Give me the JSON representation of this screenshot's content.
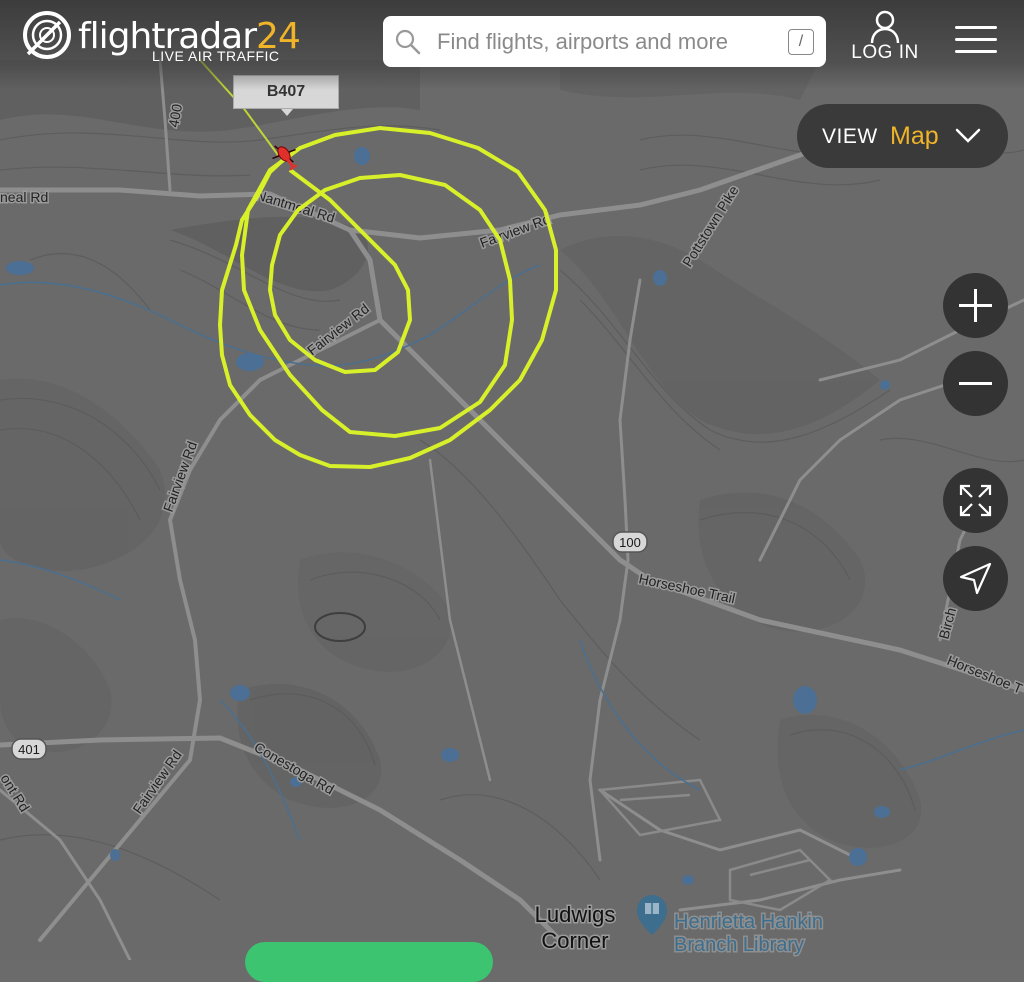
{
  "header": {
    "logo_name": "flightradar",
    "logo_num": "24",
    "logo_sub": "LIVE AIR TRAFFIC",
    "search_placeholder": "Find flights, airports and more",
    "search_shortcut": "/",
    "login_label": "LOG IN"
  },
  "view": {
    "label": "VIEW",
    "value": "Map"
  },
  "aircraft": {
    "callsign": "B407",
    "track_color": "#d8f02a",
    "icon_color": "#e0302c"
  },
  "map_labels": {
    "roads": [
      "Nantmeal Rd",
      "neal Rd",
      "Fairview Rd",
      "Pottstown Pike",
      "Fairview Rd",
      "Fairview Rd",
      "Horseshoe Trail",
      "Horseshoe T",
      "Conestoga Rd",
      "Fairview Rd",
      "ont Rd",
      "Birch"
    ],
    "route_shields": [
      "100",
      "401",
      "400"
    ],
    "places": [
      "Ludwigs",
      "Corner"
    ],
    "poi": [
      "Henrietta Hankin",
      "Branch Library"
    ]
  },
  "icons": [
    "logo-radar-icon",
    "search-icon",
    "user-icon",
    "menu-icon",
    "chevron-down-icon",
    "plus-icon",
    "minus-icon",
    "expand-icon",
    "locate-arrow-icon",
    "library-pin-icon",
    "helicopter-icon"
  ]
}
